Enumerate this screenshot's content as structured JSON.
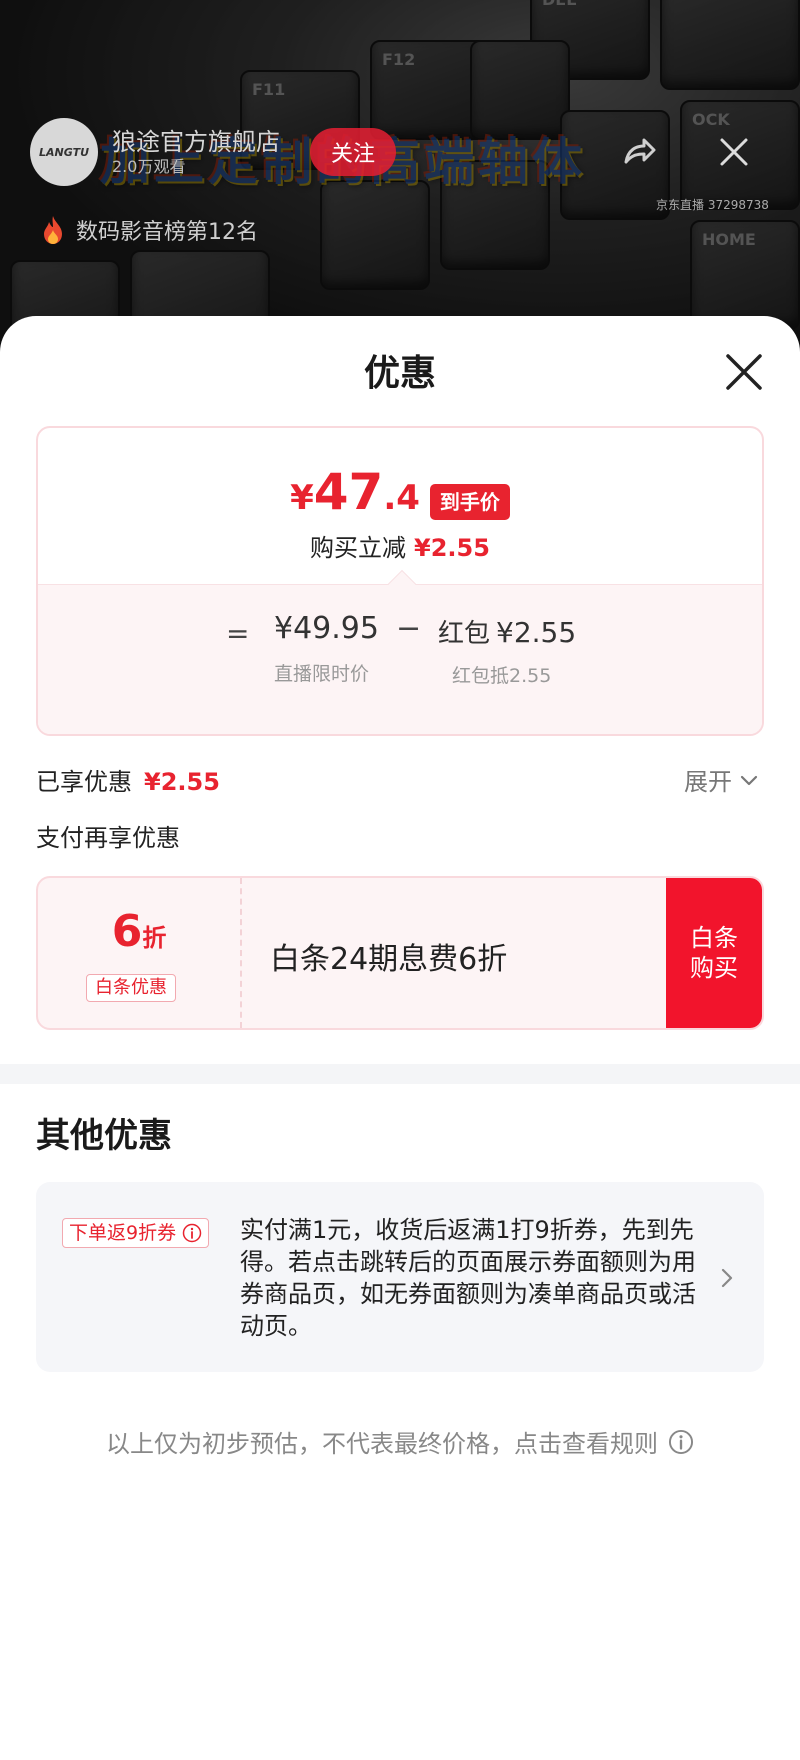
{
  "stream": {
    "host_name": "狼途官方旗舰店",
    "avatar_text": "LANGTU",
    "viewers": "2.0万观看",
    "follow_label": "关注",
    "banner_text": "加上定制的高端轴体",
    "room_id": "京东直播 37298738",
    "rank_text": "数码影音榜第12名",
    "keys": [
      "DEL",
      "F12",
      "F11",
      "OCK",
      "HOME"
    ]
  },
  "sheet": {
    "title": "优惠",
    "price_card": {
      "final_yen": "¥",
      "final_int": "47",
      "final_dec": ".4",
      "final_tag": "到手价",
      "instant_label": "购买立减",
      "instant_amount": "¥2.55",
      "eq": "=",
      "live_price": "¥49.95",
      "live_price_label": "直播限时价",
      "minus": "−",
      "red_label": "红包",
      "red_amount": "¥2.55",
      "red_desc": "红包抵2.55"
    },
    "enjoyed_label": "已享优惠",
    "enjoyed_amount": "¥2.55",
    "expand_label": "展开",
    "pay_more_label": "支付再享优惠",
    "baitiao": {
      "discount_num": "6",
      "discount_unit": "折",
      "tag": "白条优惠",
      "desc": "白条24期息费6折",
      "buy_label": "白条购买"
    },
    "other_title": "其他优惠",
    "coupon": {
      "tag": "下单返9折券",
      "text": "实付满1元，收货后返满1打9折券，先到先得。若点击跳转后的页面展示券面额则为用券商品页，如无券面额则为凑单商品页或活动页。"
    },
    "disclaimer": "以上仅为初步预估，不代表最终价格，点击查看规则"
  },
  "colors": {
    "accent_red": "#e8232f",
    "buy_red": "#f2142c",
    "card_border": "#f9d9dd",
    "card_bg": "#fdf4f5"
  }
}
